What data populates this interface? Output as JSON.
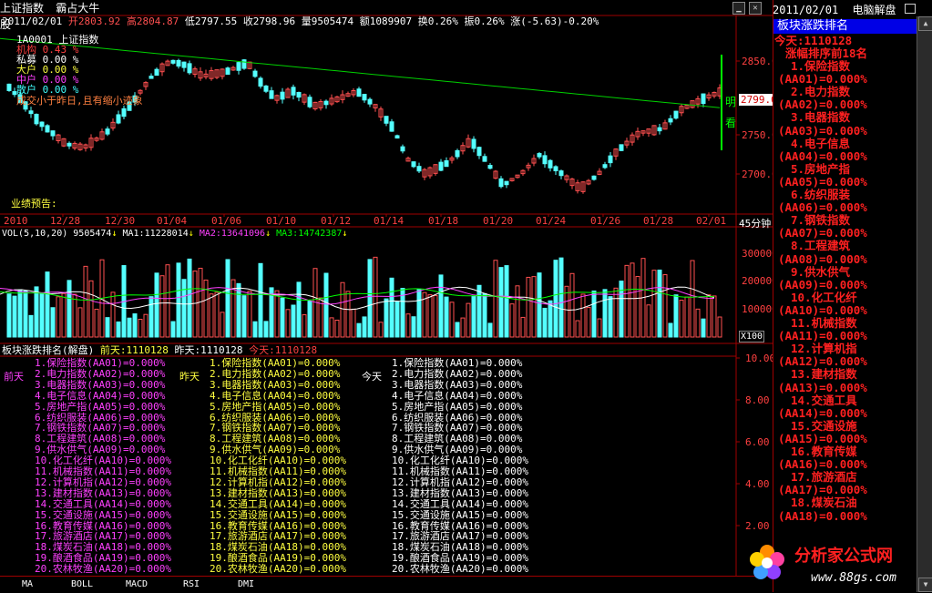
{
  "window": {
    "index_name": "上证指数",
    "strategy_name": "霸占大牛股",
    "minimize_icon": "minimize-icon",
    "close_icon": "close-icon"
  },
  "ohlc": {
    "date": "2011/02/01",
    "open": "开2803.92",
    "high": "高2804.87",
    "low": "低2797.55",
    "close": "收2798.96",
    "volume": "量9505474",
    "amount": "额1089907",
    "turnover": "换0.26%",
    "amplitude": "振0.26%",
    "change": "涨(-5.63)-0.20%"
  },
  "main_chart": {
    "legend": [
      "1A0001 上证指数",
      "机构 0.43 %",
      "私募 0.00 %",
      "大户 0.00 %",
      "中户 0.00 %",
      "散户 0.00 %"
    ],
    "condition_text": "成交小于昨日,且有缩小迹象",
    "forecast_label": "业绩预告:",
    "signal_top": "明",
    "signal_bottom": "看",
    "price_ticks": [
      "2850.0",
      "2799.0",
      "2750.0",
      "2700.0"
    ],
    "current_price": "2799.0",
    "date_ticks": [
      "2010",
      "12/28",
      "12/30",
      "01/04",
      "01/06",
      "01/10",
      "01/12",
      "01/14",
      "01/18",
      "01/20",
      "01/24",
      "01/26",
      "01/28",
      "02/01"
    ],
    "period": "45分钟"
  },
  "volume_chart": {
    "label": "VOL(5,10,20)",
    "vol": "9505474",
    "ma1": "MA1:11228014",
    "ma2": "MA2:13641096",
    "ma3": "MA3:14742387",
    "ticks": [
      "300000",
      "200000",
      "100000"
    ],
    "unit": "X100",
    "colors": {
      "up": "#ff5050",
      "down": "#54ffff",
      "ma1": "#ffffff",
      "ma2": "#ff40ff",
      "ma3": "#00ff00"
    }
  },
  "sector_panel": {
    "title": "板块涨跌排名(解盘)",
    "today_label": "前天:1110128",
    "yesterday_label": "昨天:1110128",
    "now_label": "今天:1110128",
    "col_labels": [
      "前天",
      "昨天",
      "今天"
    ],
    "ticks": [
      "10.00",
      "8.00",
      "6.00",
      "4.00",
      "2.00"
    ],
    "items": [
      "1.保险指数(AA01)=0.000%",
      "2.电力指数(AA02)=0.000%",
      "3.电器指数(AA03)=0.000%",
      "4.电子信息(AA04)=0.000%",
      "5.房地产指(AA05)=0.000%",
      "6.纺织服装(AA06)=0.000%",
      "7.钢铁指数(AA07)=0.000%",
      "8.工程建筑(AA08)=0.000%",
      "9.供水供气(AA09)=0.000%",
      "10.化工化纤(AA10)=0.000%",
      "11.机械指数(AA11)=0.000%",
      "12.计算机指(AA12)=0.000%",
      "13.建材指数(AA13)=0.000%",
      "14.交通工具(AA14)=0.000%",
      "15.交通设施(AA15)=0.000%",
      "16.教育传媒(AA16)=0.000%",
      "17.旅游酒店(AA17)=0.000%",
      "18.煤炭石油(AA18)=0.000%",
      "19.酿酒食品(AA19)=0.000%",
      "20.农林牧渔(AA20)=0.000%"
    ]
  },
  "right_panel": {
    "date": "2011/02/01",
    "title": "电脑解盘",
    "box_title": "板块涨跌排名",
    "today": "今天:1110128",
    "subtitle": "涨幅排序前18名",
    "lines": [
      "1.保险指数",
      "(AA01)=0.000%",
      "2.电力指数",
      "(AA02)=0.000%",
      "3.电器指数",
      "(AA03)=0.000%",
      "4.电子信息",
      "(AA04)=0.000%",
      "5.房地产指",
      "(AA05)=0.000%",
      "6.纺织服装",
      "(AA06)=0.000%",
      "7.钢铁指数",
      "(AA07)=0.000%",
      "8.工程建筑",
      "(AA08)=0.000%",
      "9.供水供气",
      "(AA09)=0.000%",
      "10.化工化纤",
      "(AA10)=0.000%",
      "11.机械指数",
      "(AA11)=0.000%",
      "12.计算机指",
      "(AA12)=0.000%",
      "13.建材指数",
      "(AA13)=0.000%",
      "14.交通工具",
      "(AA14)=0.000%",
      "15.交通设施",
      "(AA15)=0.000%",
      "16.教育传媒",
      "(AA16)=0.000%",
      "17.旅游酒店",
      "(AA17)=0.000%",
      "18.煤炭石油",
      "(AA18)=0.000%"
    ]
  },
  "tabs": [
    "MA",
    "BOLL",
    "MACD",
    "RSI",
    "DMI"
  ],
  "logo": {
    "name": "分析家公式网",
    "url": "www.88gs.com"
  },
  "colors": {
    "border": "#a00000",
    "up": "#ff5050",
    "down": "#54ffff",
    "ma": "#00d000",
    "accent": "#ff2020",
    "title_box": "#0000e6"
  }
}
